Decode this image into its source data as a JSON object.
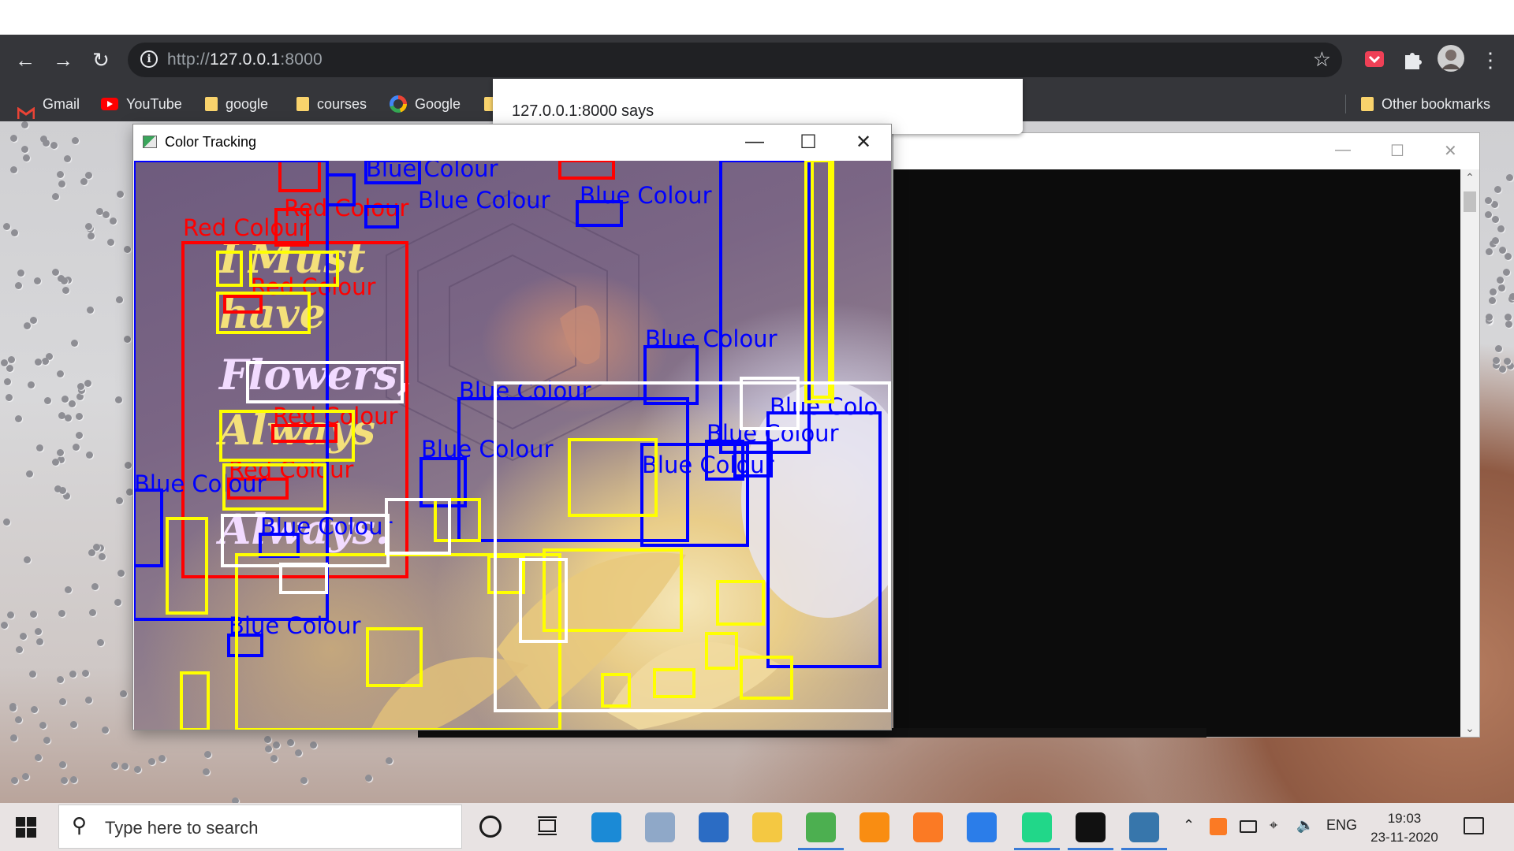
{
  "browser": {
    "url_prefix": "http://",
    "url_host": "127.0.0.1",
    "url_port": ":8000",
    "bookmarks": [
      {
        "label": "Gmail",
        "icon": "gmail-icon"
      },
      {
        "label": "YouTube",
        "icon": "youtube-icon"
      },
      {
        "label": "google",
        "icon": "folder-icon"
      },
      {
        "label": "courses",
        "icon": "folder-icon"
      },
      {
        "label": "Google",
        "icon": "google-icon"
      }
    ],
    "other_bookmarks": "Other bookmarks"
  },
  "alert": {
    "message": "127.0.0.1:8000 says"
  },
  "color_tracking_window": {
    "title": "Color Tracking",
    "frame_text": {
      "i": "I",
      "must": "Must",
      "have": "have",
      "flowers": "Flowers,",
      "always1": "Always",
      "always2": "Always."
    },
    "labels": {
      "blue": "Blue Colour",
      "red": "Red Colour",
      "blue_cut": "Blue Colo"
    },
    "colors": {
      "blue": "#0000ff",
      "red": "#ff0000",
      "yellow": "#ffff00",
      "white": "#ffffff"
    }
  },
  "taskbar": {
    "search_placeholder": "Type here to search",
    "language": "ENG",
    "time": "19:03",
    "date": "23-11-2020",
    "apps": [
      {
        "name": "edge-icon",
        "color": "#1b8ad6"
      },
      {
        "name": "file-manager-icon",
        "color": "#8fa8c8"
      },
      {
        "name": "mail-icon",
        "color": "#2b6cc4"
      },
      {
        "name": "file-explorer-icon",
        "color": "#f4c842"
      },
      {
        "name": "chrome-icon",
        "color": "#4caf50"
      },
      {
        "name": "sublime-icon",
        "color": "#f98d12"
      },
      {
        "name": "xampp-icon",
        "color": "#fb7a24"
      },
      {
        "name": "wps-icon",
        "color": "#2b7de9"
      },
      {
        "name": "pycharm-icon",
        "color": "#21d789"
      },
      {
        "name": "terminal-icon",
        "color": "#111111"
      },
      {
        "name": "python-icon",
        "color": "#3776ab"
      }
    ]
  }
}
